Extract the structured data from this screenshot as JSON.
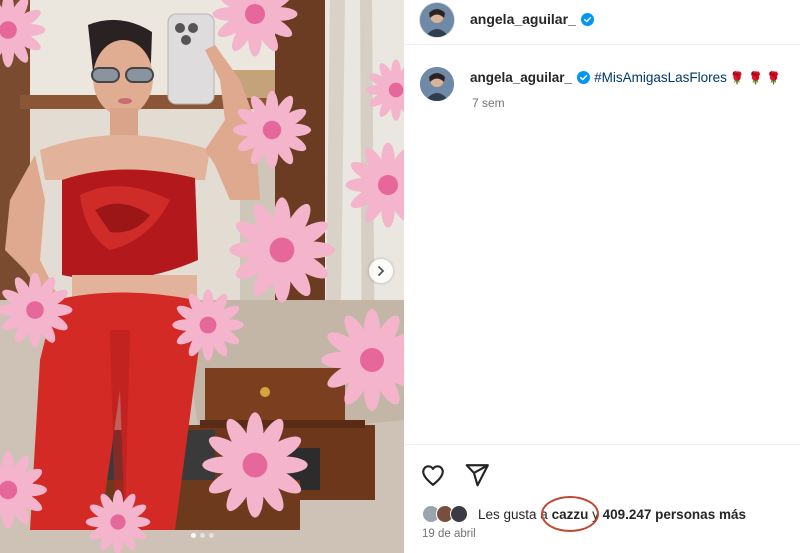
{
  "header": {
    "username": "angela_aguilar_",
    "verified": true
  },
  "caption": {
    "username": "angela_aguilar_",
    "hashtag": "#MisAmigasLasFlores",
    "emoji": "🌹 🌹 🌹",
    "time": "7 sem"
  },
  "actions": {
    "like_icon": "heart-icon",
    "share_icon": "send-icon"
  },
  "likes": {
    "prefix": "Les gusta a",
    "user": "cazzu",
    "suffix": "y",
    "count_text": "409.247 personas más"
  },
  "date": "19 de abril",
  "carousel": {
    "dots": 3,
    "active_index": 0
  },
  "colors": {
    "link": "#00376b",
    "verified": "#0095f6",
    "annotation": "#c0462f",
    "outfit": "#d42a26"
  }
}
